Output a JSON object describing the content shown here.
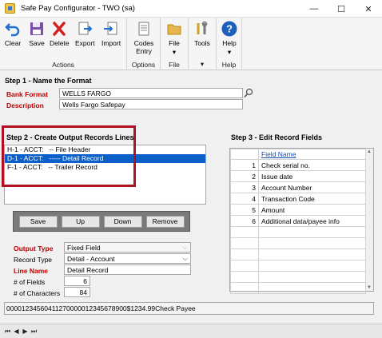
{
  "window": {
    "title": "Safe Pay Configurator  -  TWO (sa)",
    "minimize": "—",
    "maximize": "☐",
    "close": "✕"
  },
  "ribbon": {
    "groups": [
      {
        "label": "Actions",
        "buttons": [
          "Clear",
          "Save",
          "Delete",
          "Export",
          "Import"
        ]
      },
      {
        "label": "Options",
        "buttons": [
          "Codes Entry"
        ]
      },
      {
        "label": "File",
        "buttons": [
          "File"
        ]
      },
      {
        "label": "",
        "buttons": [
          "Tools"
        ]
      },
      {
        "label": "Help",
        "buttons": [
          "Help"
        ]
      }
    ],
    "icons": {
      "clear": "undo-arrow",
      "save": "floppy-disk",
      "delete": "red-x",
      "export": "document-export",
      "import": "document-import",
      "codes": "document-lines",
      "file": "folder",
      "tools": "wrench-screwdriver",
      "help": "question-circle"
    }
  },
  "step1": {
    "heading": "Step 1 - Name the Format",
    "bank_format_label": "Bank Format",
    "bank_format_value": "WELLS FARGO",
    "description_label": "Description",
    "description_value": "Wells Fargo Safepay"
  },
  "step2": {
    "heading": "Step 2 - Create Output Records Lines",
    "records": [
      {
        "text": "H-1 - ACCT:   -- File Header",
        "selected": false
      },
      {
        "text": "D-1 - ACCT:   ----- Detail Record",
        "selected": true
      },
      {
        "text": "F-1 - ACCT:   -- Trailer Record",
        "selected": false
      }
    ],
    "buttons": {
      "save": "Save",
      "up": "Up",
      "down": "Down",
      "remove": "Remove"
    }
  },
  "record_props": {
    "output_type_label": "Output Type",
    "output_type_value": "Fixed Field",
    "record_type_label": "Record Type",
    "record_type_value": "Detail - Account",
    "line_name_label": "Line Name",
    "line_name_value": "Detail Record",
    "num_fields_label": "# of Fields",
    "num_fields_value": "6",
    "num_chars_label": "# of Characters",
    "num_chars_value": "84"
  },
  "step3": {
    "heading": "Step 3 - Edit Record Fields",
    "column_header": "Field Name",
    "fields": [
      {
        "num": "1",
        "name": "Check serial no."
      },
      {
        "num": "2",
        "name": "Issue date"
      },
      {
        "num": "3",
        "name": "Account Number"
      },
      {
        "num": "4",
        "name": "Transaction Code"
      },
      {
        "num": "5",
        "name": "Amount"
      },
      {
        "num": "6",
        "name": "Additional data/payee info"
      }
    ]
  },
  "preview_line": "00001234560411270000012345678900$1234.99Check Payee",
  "colors": {
    "accent_red": "#c00000",
    "selection_blue": "#0a60c8",
    "highlight_box": "#b01020"
  }
}
